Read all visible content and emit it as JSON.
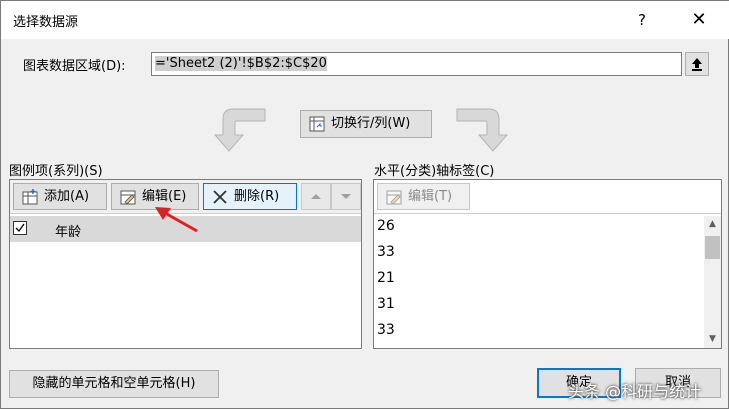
{
  "window": {
    "title": "选择数据源",
    "help": "?",
    "close": "✕"
  },
  "range": {
    "label": "图表数据区域(D):",
    "value": "='Sheet2 (2)'!$B$2:$C$20"
  },
  "switch_button": {
    "label": "切换行/列(W)"
  },
  "legend": {
    "label": "图例项(系列)(S)",
    "add_label": "添加(A)",
    "edit_label": "编辑(E)",
    "delete_label": "删除(R)",
    "series": [
      {
        "name": "年龄",
        "checked": true
      }
    ]
  },
  "axis": {
    "label": "水平(分类)轴标签(C)",
    "edit_label": "编辑(T)",
    "items": [
      "26",
      "33",
      "21",
      "31",
      "33"
    ]
  },
  "footer": {
    "hidden_cells_label": "隐藏的单元格和空单元格(H)",
    "ok_label": "确定",
    "cancel_label": "取消",
    "watermark": "头条 @科研与统计"
  },
  "colors": {
    "accent": "#0078d7",
    "arrow": "#e02020"
  }
}
